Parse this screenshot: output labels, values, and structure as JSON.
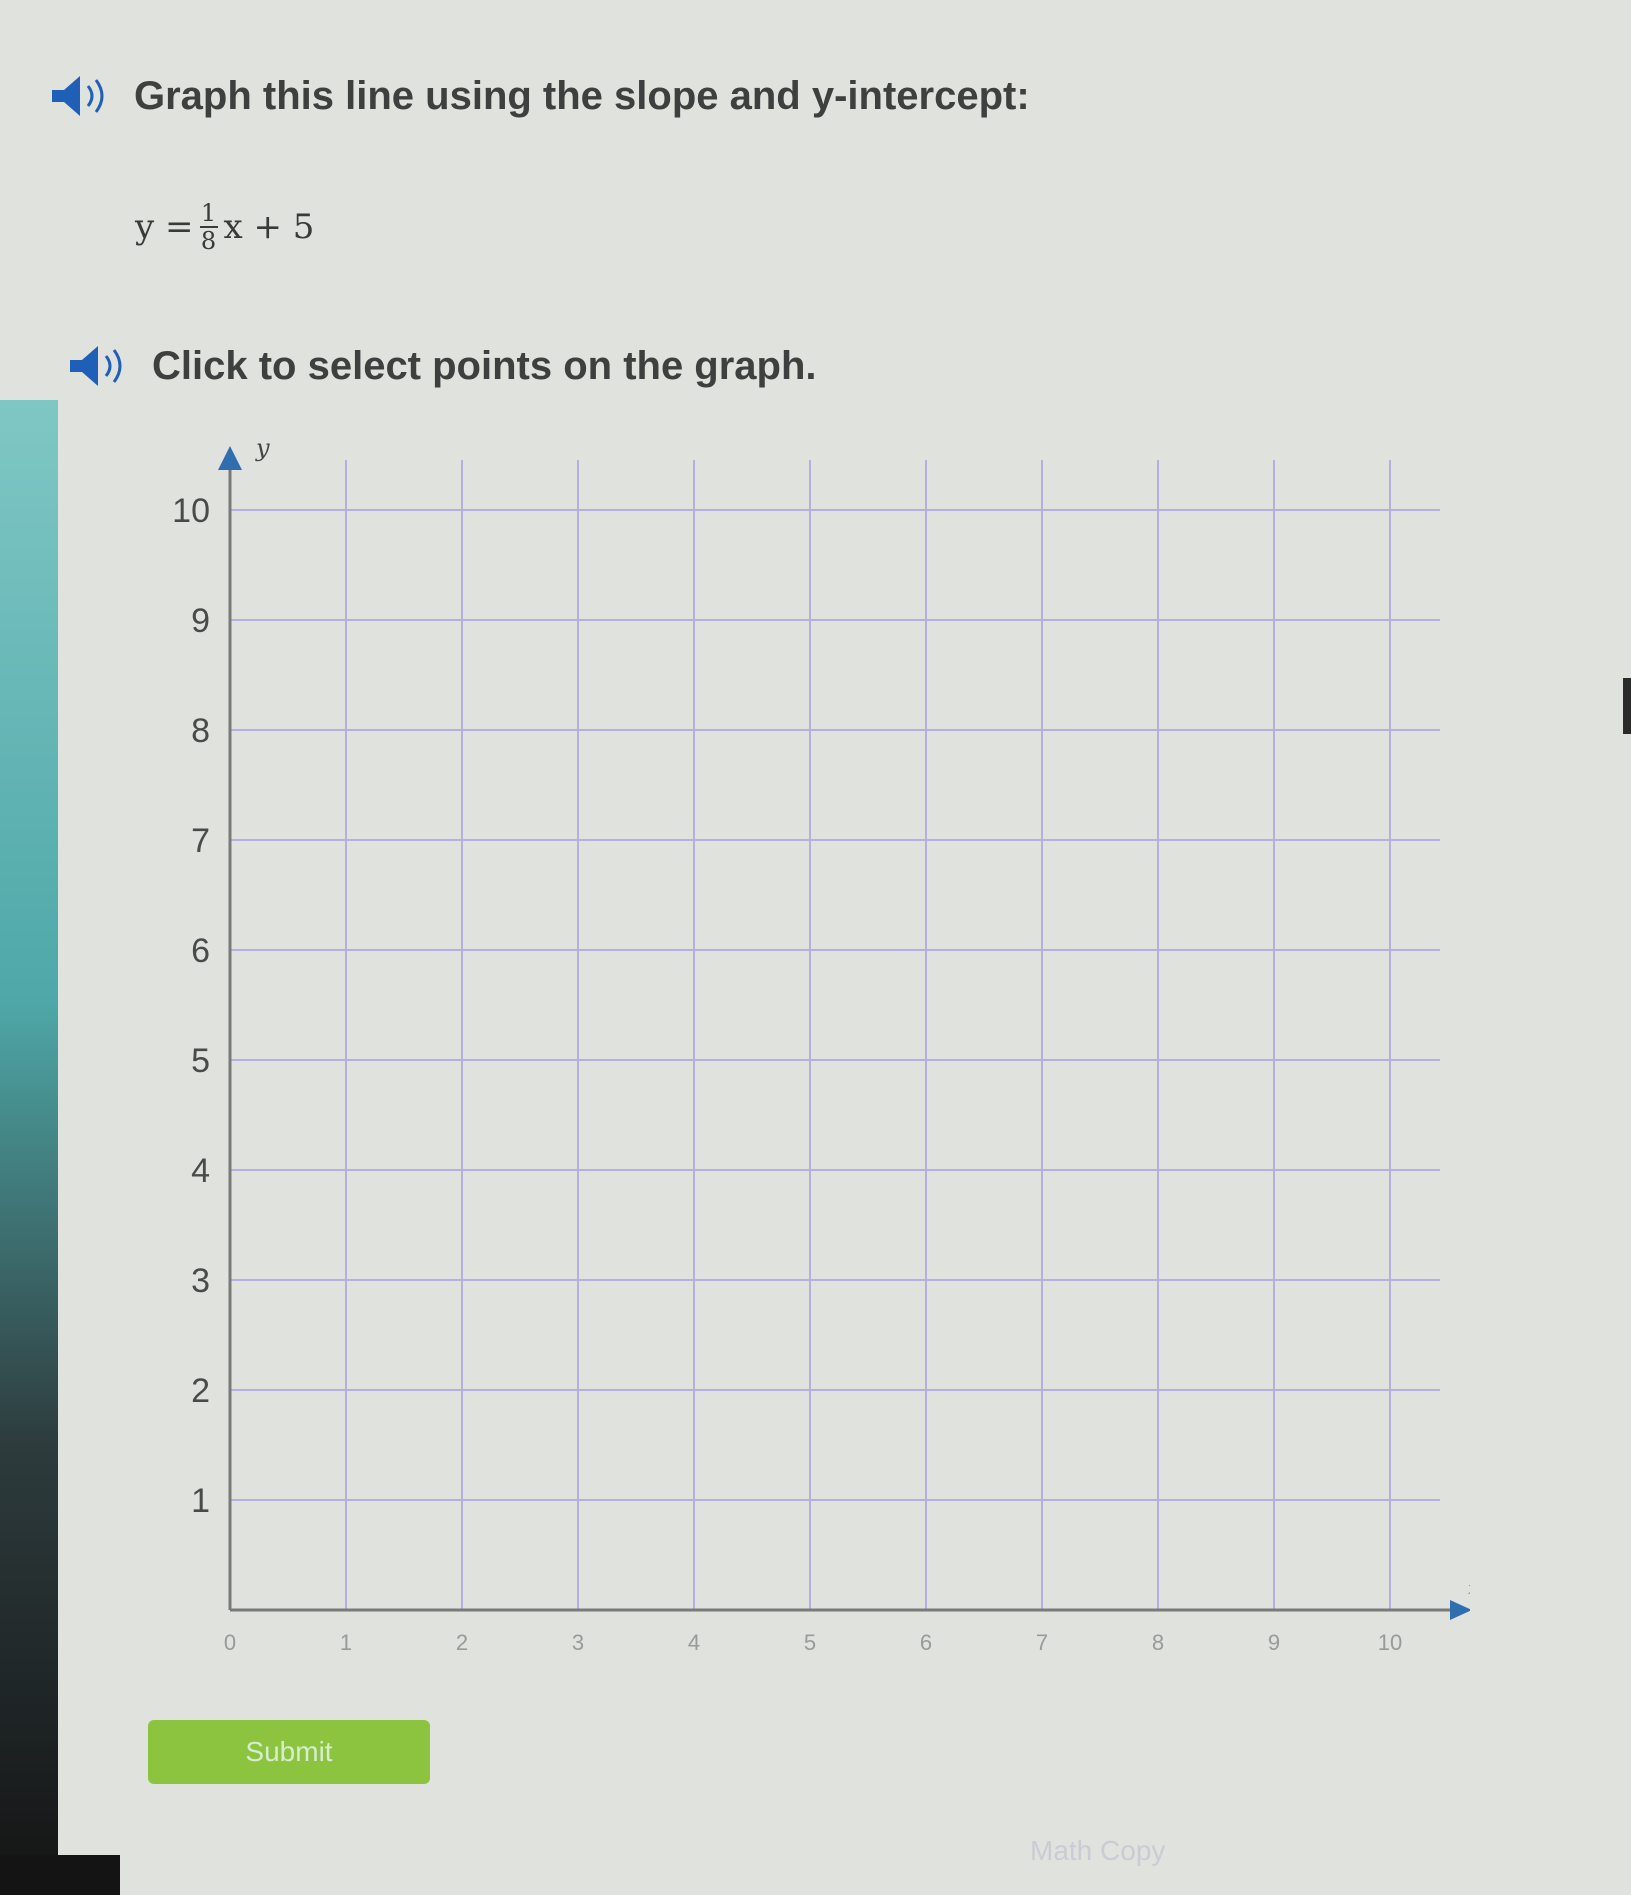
{
  "question": {
    "prompt": "Graph this line using the slope and y-intercept:",
    "equation": {
      "lhs": "y =",
      "numerator": "1",
      "denominator": "8",
      "rest": "x + 5"
    },
    "instruction": "Click to select points on the graph."
  },
  "graph": {
    "y_axis_label": "y",
    "x_axis_label": "x",
    "x_range": [
      0,
      10
    ],
    "y_range": [
      0,
      10
    ],
    "y_ticks": [
      "1",
      "2",
      "3",
      "4",
      "5",
      "6",
      "7",
      "8",
      "9",
      "10"
    ],
    "x_ticks": [
      "0",
      "1",
      "2",
      "3",
      "4",
      "5",
      "6",
      "7",
      "8",
      "9",
      "10"
    ],
    "grid": true
  },
  "actions": {
    "submit_label": "Submit",
    "secondary_label": "Math Copy"
  },
  "colors": {
    "grid_line": "#b3b0e0",
    "axis_line": "#7a7a7a",
    "axis_arrow": "#2f6fb0",
    "submit_bg": "#8cc43f",
    "speaker_icon": "#1f5fb8"
  }
}
